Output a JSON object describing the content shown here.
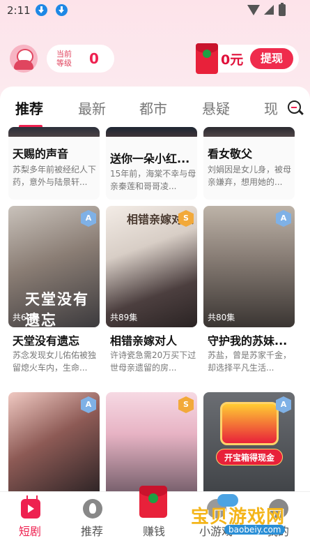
{
  "status_bar": {
    "time": "2:11"
  },
  "header": {
    "level_label": "当前等级",
    "level_value": "0",
    "wallet_amount": "0元",
    "withdraw_label": "提现"
  },
  "tabs": [
    {
      "label": "推荐",
      "active": true
    },
    {
      "label": "最新",
      "active": false
    },
    {
      "label": "都市",
      "active": false
    },
    {
      "label": "悬疑",
      "active": false
    },
    {
      "label": "现",
      "active": false
    }
  ],
  "top_row": [
    {
      "title": "天赐的声音",
      "desc": "苏梨多年前被经纪人下药，意外与陆景轩..."
    },
    {
      "title": "送你一朵小红...",
      "desc": "15年前，海棠不幸与母亲秦莲和哥哥凌..."
    },
    {
      "title": "看女敬父",
      "desc": "刘娟因是女儿身，被母亲嫌弃，想用她的..."
    }
  ],
  "mid_row": [
    {
      "title": "天堂没有遗忘",
      "desc": "苏念发现女儿佑佑被独留熄火车内，生命...",
      "episodes": "共60集",
      "rating": "A",
      "poster_text": "天堂没有遗忘"
    },
    {
      "title": "相错亲嫁对人",
      "desc": "许诗瓷急需20万买下过世母亲遗留的房...",
      "episodes": "共89集",
      "rating": "S",
      "poster_text": "相错亲嫁对人"
    },
    {
      "title": "守护我的苏妹...",
      "desc": "苏盐，曾是苏家千金，却选择平凡生活...",
      "episodes": "共80集",
      "rating": "A",
      "poster_text": ""
    }
  ],
  "bottom_row": [
    {
      "rating": "A"
    },
    {
      "rating": "S"
    },
    {
      "rating": "A",
      "banner": "开宝箱得现金"
    }
  ],
  "bottom_nav": [
    {
      "label": "短剧",
      "active": true,
      "icon": "tv-icon"
    },
    {
      "label": "推荐",
      "active": false,
      "icon": "fire-icon"
    },
    {
      "label": "赚钱",
      "active": false,
      "icon": "red-packet-icon"
    },
    {
      "label": "小游戏",
      "active": false,
      "icon": "game-icon"
    },
    {
      "label": "我的",
      "active": false,
      "icon": "face-icon"
    }
  ],
  "watermark": {
    "text": "宝贝游戏网",
    "url": "baobeiy.com"
  },
  "colors": {
    "accent": "#ee2150",
    "header_bg": "#fde3ea"
  }
}
